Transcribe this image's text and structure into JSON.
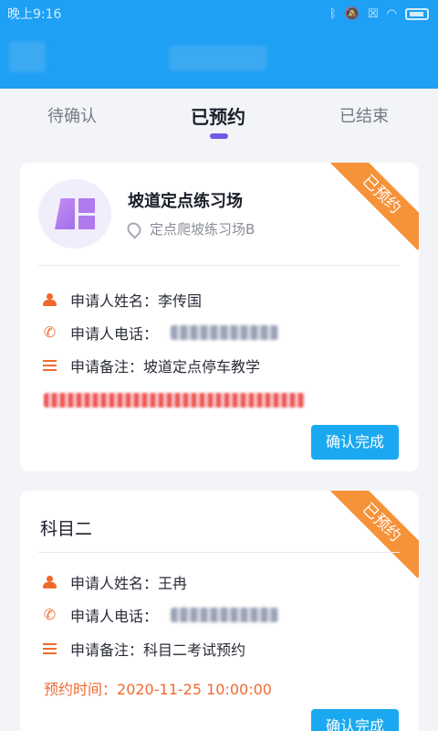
{
  "status_bar": {
    "time": "晚上9:16"
  },
  "tabs": [
    {
      "label": "待确认"
    },
    {
      "label": "已预约"
    },
    {
      "label": "已结束"
    }
  ],
  "cards": [
    {
      "ribbon": "已预约",
      "venue_name": "坡道定点练习场",
      "venue_sub": "定点爬坡练习场B",
      "name_label": "申请人姓名：",
      "name_value": "李传国",
      "phone_label": "申请人电话：",
      "note_label": "申请备注：",
      "note_value": "坡道定点停车教学",
      "button": "确认完成"
    },
    {
      "ribbon": "已预约",
      "subject": "科目二",
      "name_label": "申请人姓名：",
      "name_value": "王冉",
      "phone_label": "申请人电话：",
      "note_label": "申请备注：",
      "note_value": "科目二考试预约",
      "time_label": "预约时间：",
      "time_value": "2020-11-25 10:00:00",
      "button": "确认完成"
    }
  ],
  "colors": {
    "header": "#1ea0f5",
    "accent": "#f06a2f",
    "ribbon": "#f5923a",
    "tab_indicator": "#6f5ae6",
    "button": "#1aa9f0"
  }
}
